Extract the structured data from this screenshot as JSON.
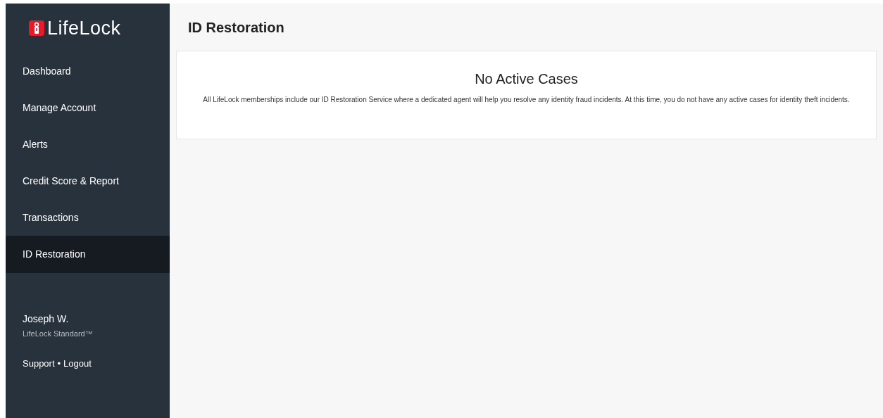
{
  "logo": {
    "text": "**Life**Lock"
  },
  "nav": [
    {
      "label": "Dashboard",
      "selected": false
    },
    {
      "label": "Manage Account",
      "selected": false
    },
    {
      "label": "Alerts",
      "selected": false
    },
    {
      "label": "Credit Score & Report",
      "selected": false
    },
    {
      "label": "Transactions",
      "selected": false
    },
    {
      "label": "ID Restoration",
      "selected": true
    }
  ],
  "user": {
    "name": "Joseph W.",
    "plan": "LifeLock Standard™"
  },
  "links": [
    "Support",
    "•",
    "Logout"
  ],
  "page_title": "ID Restoration",
  "card": {
    "title": "No Active Cases",
    "text": "All LifeLock memberships include our ID Restoration Service where a dedicated agent will help you resolve any identity fraud incidents. At this time, you do not have any active cases for identity theft incidents."
  }
}
